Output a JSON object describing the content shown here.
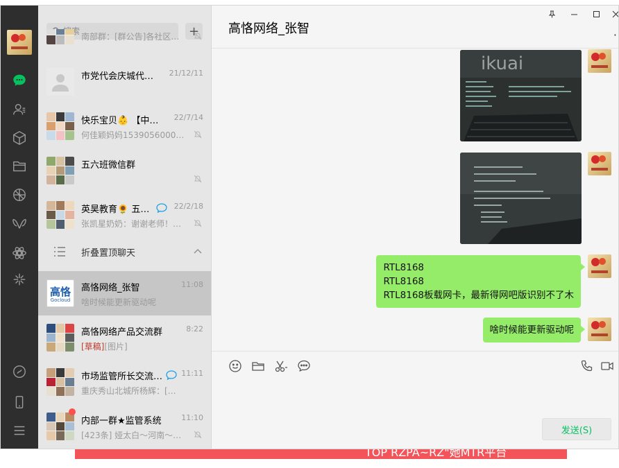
{
  "search": {
    "placeholder": "搜索"
  },
  "add_button": "+",
  "rail": {
    "icons": [
      "chat-icon",
      "contacts-icon",
      "favorites-icon",
      "files-icon",
      "moments-icon",
      "channels-icon",
      "search-discover-icon",
      "miniprogram-icon",
      "phone-icon",
      "menu-icon"
    ]
  },
  "conversations": [
    {
      "name": "",
      "time": "",
      "preview": "南部群：[群公告]各社区…",
      "muted": true
    },
    {
      "name": "市党代会庆城代…",
      "time": "21/12/11",
      "preview": "",
      "muted": false
    },
    {
      "name": "快乐宝贝👶 【中…",
      "time": "22/7/14",
      "preview": "何佳颖妈妈1539056000…",
      "muted": true
    },
    {
      "name": "五六班微信群",
      "time": "",
      "preview": "",
      "muted": true
    },
    {
      "name": "英昊教育🌻 五…",
      "time": "22/2/18",
      "preview": "张凯星奶奶：谢谢老师！…",
      "muted": true
    }
  ],
  "fold": {
    "label": "折叠置顶聊天"
  },
  "conversations_below": [
    {
      "name": "高恪网络_张智",
      "time": "11:08",
      "preview": "啥时候能更新驱动呢",
      "thumb_text": "高恪",
      "thumb_sub": "Gocloud",
      "active": true
    },
    {
      "name": "高恪网络产品交流群",
      "time": "8:22",
      "draft": "[草稿]",
      "preview": "[图片]",
      "active": false
    },
    {
      "name": "市场监管所长交流…",
      "time": "11:11",
      "preview": "重庆秀山北城所杨辉：[…",
      "active": false
    },
    {
      "name": "内部一群★监管系统",
      "time": "11:10",
      "preview": "[423条] 娅太白～河南～…",
      "active": false,
      "muted": true
    }
  ],
  "chat": {
    "title": "高恪网络_张智",
    "messages": [
      {
        "type": "image",
        "caption": "ikuai"
      },
      {
        "type": "image",
        "caption": ""
      },
      {
        "type": "text",
        "lines": [
          "RTL8168",
          "RTL8168",
          "RTL8168板载网卡，最新得网吧版识别不了木"
        ]
      },
      {
        "type": "text",
        "lines": [
          "啥时候能更新驱动呢"
        ]
      }
    ]
  },
  "composer": {
    "tools": [
      "emoji-icon",
      "folder-icon",
      "scissors-icon",
      "chat-history-icon"
    ],
    "right_tools": [
      "phone-call-icon",
      "video-call-icon"
    ],
    "send_label": "发送(S)"
  },
  "backdrop": {
    "text": "TOP RZPA~RZ\"她MTR平台"
  },
  "colors": {
    "accent": "#07c160",
    "bubble": "#95ec69",
    "rail": "#2e2e2e"
  }
}
